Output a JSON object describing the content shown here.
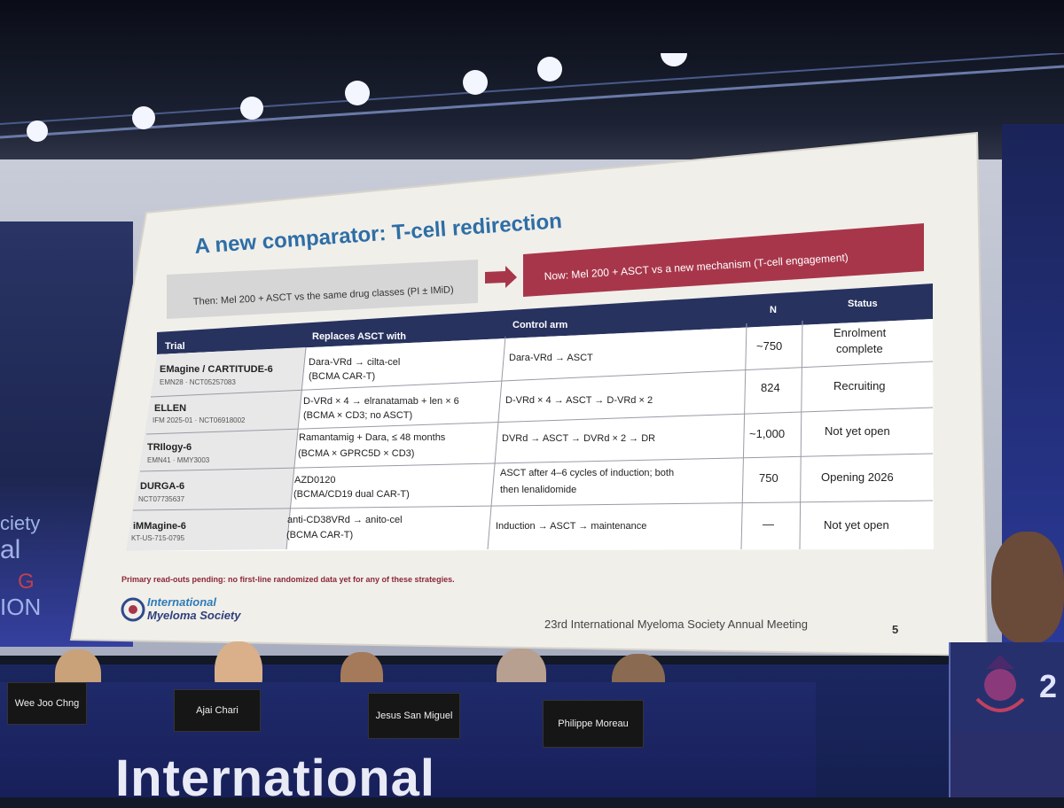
{
  "slide": {
    "title": "A new comparator: T-cell redirection",
    "then_box": "Then: Mel 200 + ASCT vs the same drug classes (PI ± IMiD)",
    "now_box": "Now: Mel 200 + ASCT vs a new mechanism (T-cell engagement)",
    "table": {
      "headers": [
        "Trial",
        "Replaces ASCT with",
        "Control arm",
        "N",
        "Status"
      ],
      "rows": [
        {
          "trial": "EMagine / CARTITUDE-6",
          "trial_sub": "EMN28 · NCT05257083",
          "replaces_1": "Dara-VRd → cilta-cel",
          "replaces_2": "(BCMA CAR-T)",
          "control_1": "Dara-VRd → ASCT",
          "control_2": "",
          "n": "~750",
          "status_1": "Enrolment",
          "status_2": "complete"
        },
        {
          "trial": "ELLEN",
          "trial_sub": "IFM 2025-01 · NCT06918002",
          "replaces_1": "D-VRd × 4 → elranatamab + len × 6",
          "replaces_2": "(BCMA × CD3; no ASCT)",
          "control_1": "D-VRd × 4 → ASCT → D-VRd × 2",
          "control_2": "",
          "n": "824",
          "status_1": "Recruiting",
          "status_2": ""
        },
        {
          "trial": "TRIlogy-6",
          "trial_sub": "EMN41 · MMY3003",
          "replaces_1": "Ramantamig + Dara, ≤ 48 months",
          "replaces_2": "(BCMA × GPRC5D × CD3)",
          "control_1": "DVRd → ASCT → DVRd × 2 → DR",
          "control_2": "",
          "n": "~1,000",
          "status_1": "Not yet open",
          "status_2": ""
        },
        {
          "trial": "DURGA-6",
          "trial_sub": "NCT07735637",
          "replaces_1": "AZD0120",
          "replaces_2": "(BCMA/CD19 dual CAR-T)",
          "control_1": "ASCT after 4–6 cycles of induction; both",
          "control_2": "then lenalidomide",
          "n": "750",
          "status_1": "Opening 2026",
          "status_2": ""
        },
        {
          "trial": "iMMagine-6",
          "trial_sub": "KT-US-715-0795",
          "replaces_1": "anti-CD38VRd → anito-cel",
          "replaces_2": "(BCMA CAR-T)",
          "control_1": "Induction → ASCT → maintenance",
          "control_2": "",
          "n": "—",
          "status_1": "Not yet open",
          "status_2": ""
        }
      ]
    },
    "footnote": "Primary read-outs pending: no first-line randomized data yet for any of these strategies.",
    "logo_line1": "International",
    "logo_line2": "Myeloma Society",
    "meeting": "23rd International Myeloma Society Annual Meeting",
    "page_number": "5"
  },
  "panel": {
    "nameplates": [
      "Wee Joo Chng",
      "Ajai Chari",
      "Jesus San Miguel",
      "Philippe Moreau"
    ]
  },
  "stage_banner": "International",
  "side_left_text": [
    "ciety",
    "al",
    "G",
    "ION"
  ],
  "colors": {
    "title_blue": "#2e6ea6",
    "navy": "#27325f",
    "red": "#a8364a",
    "footnote_red": "#8a2838"
  }
}
